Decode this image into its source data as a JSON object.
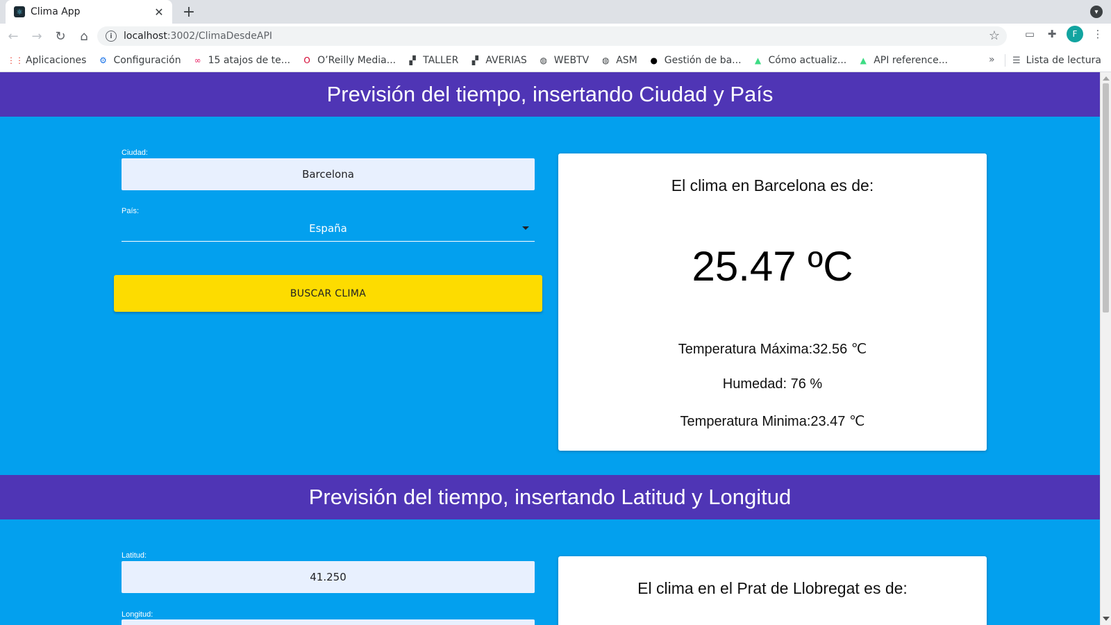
{
  "browser": {
    "tab_title": "Clima App",
    "url_host": "localhost",
    "url_path": ":3002/ClimaDesdeAPI",
    "profile_initial": "F",
    "bookmarks": [
      {
        "label": "Aplicaciones",
        "icon": "apps-grid-icon"
      },
      {
        "label": "Configuración",
        "icon": "gear-icon"
      },
      {
        "label": "15 atajos de te...",
        "icon": "infinity-icon"
      },
      {
        "label": "O’Reilly Media...",
        "icon": "oreilly-icon"
      },
      {
        "label": "TALLER",
        "icon": "chart-icon"
      },
      {
        "label": "AVERIAS",
        "icon": "chart-icon"
      },
      {
        "label": "WEBTV",
        "icon": "globe-icon"
      },
      {
        "label": "ASM",
        "icon": "globe-icon"
      },
      {
        "label": "Gestión de ba...",
        "icon": "github-icon"
      },
      {
        "label": "Cómo actualiz...",
        "icon": "android-icon"
      },
      {
        "label": "API reference...",
        "icon": "android-icon"
      }
    ],
    "more_label": "»",
    "reading_list": "Lista de lectura"
  },
  "section1": {
    "header": "Previsión del tiempo, insertando Ciudad y País",
    "city_label": "Ciudad:",
    "city_value": "Barcelona",
    "country_label": "País:",
    "country_value": "España",
    "button_label": "BUSCAR CLIMA",
    "result": {
      "title": "El clima en Barcelona es de:",
      "temperature": "25.47 ºC",
      "max": "Temperatura Máxima:32.56 ℃",
      "humidity": "Humedad: 76 %",
      "min": "Temperatura Minima:23.47 ℃"
    }
  },
  "section2": {
    "header": "Previsión del tiempo, insertando Latitud y Longitud",
    "lat_label": "Latitud:",
    "lat_value": "41.250",
    "lon_label": "Longitud:",
    "result": {
      "title": "El clima en el Prat de Llobregat es de:"
    }
  },
  "colors": {
    "header_bg": "#4f35b5",
    "page_bg": "#03a0ee",
    "button_bg": "#fddc00",
    "input_bg": "#e8f0fe"
  }
}
